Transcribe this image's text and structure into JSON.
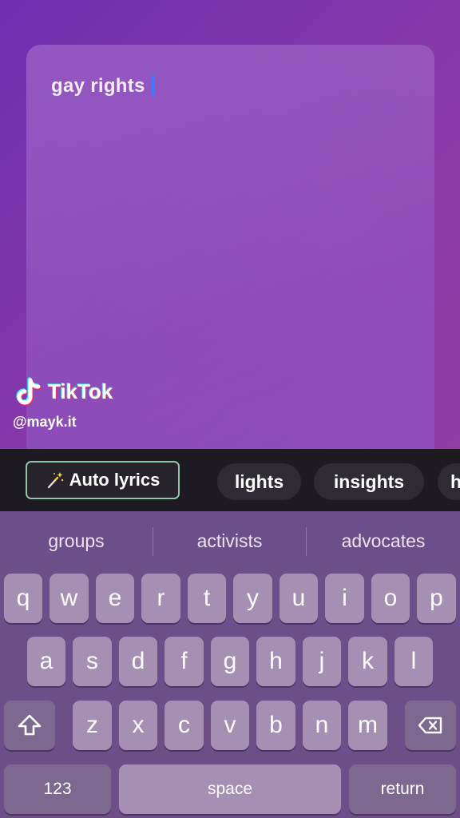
{
  "editor": {
    "lyrics_text": "gay rights"
  },
  "watermark": {
    "brand": "TikTok",
    "handle": "@mayk.it"
  },
  "suggestion_bar": {
    "auto_lyrics_label": "Auto lyrics",
    "chips": [
      "lights",
      "insights",
      "h"
    ]
  },
  "keyboard": {
    "predictions": [
      "groups",
      "activists",
      "advocates"
    ],
    "row1": [
      "q",
      "w",
      "e",
      "r",
      "t",
      "y",
      "u",
      "i",
      "o",
      "p"
    ],
    "row2": [
      "a",
      "s",
      "d",
      "f",
      "g",
      "h",
      "j",
      "k",
      "l"
    ],
    "row3": [
      "z",
      "x",
      "c",
      "v",
      "b",
      "n",
      "m"
    ],
    "numbers_label": "123",
    "space_label": "space",
    "return_label": "return",
    "shift_icon": "shift-arrow-icon",
    "delete_icon": "backspace-icon"
  },
  "colors": {
    "caret": "#3d7bff",
    "auto_lyrics_border": "#8fc6a8",
    "suggestion_bar_bg": "#1d1a22"
  }
}
